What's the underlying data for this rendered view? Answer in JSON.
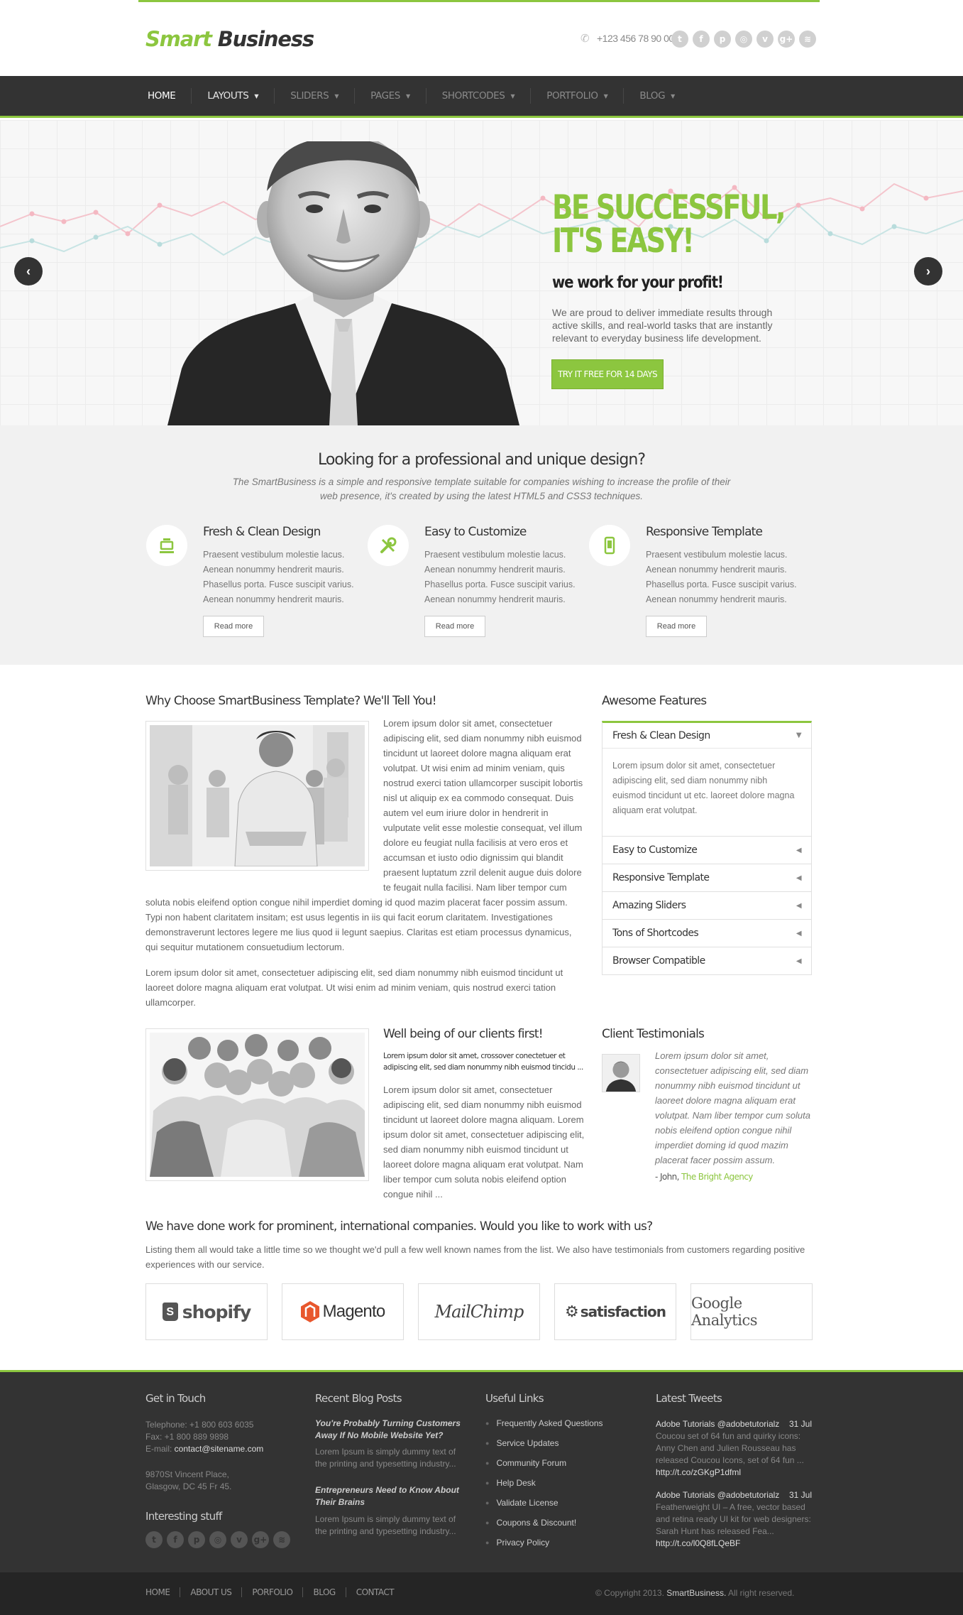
{
  "brand": {
    "word1": "Smart",
    "word2": "Business"
  },
  "header": {
    "phone": "+123 456 78 90 000",
    "social_icons": [
      "twitter-icon",
      "facebook-icon",
      "pinterest-icon",
      "dribbble-icon",
      "vimeo-icon",
      "googleplus-icon",
      "rss-icon"
    ],
    "social_glyphs": [
      "t",
      "f",
      "p",
      "◎",
      "v",
      "g+",
      "≋"
    ]
  },
  "nav": {
    "items": [
      {
        "label": "HOME"
      },
      {
        "label": "LAYOUTS"
      },
      {
        "label": "SLIDERS"
      },
      {
        "label": "PAGES"
      },
      {
        "label": "SHORTCODES"
      },
      {
        "label": "PORTFOLIO"
      },
      {
        "label": "BLOG"
      }
    ]
  },
  "hero": {
    "title_line1": "BE SUCCESSFUL,",
    "title_line2": "IT'S EASY!",
    "subtitle": "we work for your profit!",
    "text": "We are proud to deliver immediate results through active skills, and real-world tasks that are instantly relevant to everyday business life development.",
    "button": "TRY IT FREE FOR 14 DAYS",
    "prev": "‹",
    "next": "›"
  },
  "features": {
    "title": "Looking for a professional and unique design?",
    "description": "The SmartBusiness is a simple and responsive template suitable for companies wishing to increase the profile of their web presence, it's created by using the latest HTML5 and CSS3 techniques.",
    "items": [
      {
        "title": "Fresh & Clean Design",
        "text": "Praesent vestibulum molestie lacus. Aenean nonummy hendrerit mauris. Phasellus porta. Fusce suscipit varius. Aenean nonummy hendrerit mauris.",
        "button": "Read more"
      },
      {
        "title": "Easy to Customize",
        "text": "Praesent vestibulum molestie lacus. Aenean nonummy hendrerit mauris. Phasellus porta. Fusce suscipit varius. Aenean nonummy hendrerit mauris.",
        "button": "Read more"
      },
      {
        "title": "Responsive Template",
        "text": "Praesent vestibulum molestie lacus. Aenean nonummy hendrerit mauris. Phasellus porta. Fusce suscipit varius. Aenean nonummy hendrerit mauris.",
        "button": "Read more"
      }
    ]
  },
  "why": {
    "title": "Why Choose SmartBusiness Template? We'll Tell You!",
    "para1": "Lorem ipsum dolor sit amet, consectetuer adipiscing elit, sed diam nonummy nibh euismod tincidunt ut laoreet dolore magna aliquam erat volutpat. Ut wisi enim ad minim veniam, quis nostrud exerci tation ullamcorper suscipit lobortis nisl ut aliquip ex ea commodo consequat. Duis autem vel eum iriure dolor in hendrerit in vulputate velit esse molestie consequat, vel illum dolore eu feugiat nulla facilisis at vero eros et accumsan et iusto odio dignissim qui blandit praesent luptatum zzril delenit augue duis dolore te feugait nulla facilisi. Nam liber tempor cum soluta nobis eleifend option congue nihil imperdiet doming id quod mazim placerat facer possim assum. Typi non habent claritatem insitam; est usus legentis in iis qui facit eorum claritatem. Investigationes demonstraverunt lectores legere me lius quod ii legunt saepius. Claritas est etiam processus dynamicus, qui sequitur mutationem consuetudium lectorum.",
    "para2": "Lorem ipsum dolor sit amet, consectetuer adipiscing elit, sed diam nonummy nibh euismod tincidunt ut laoreet dolore magna aliquam erat volutpat. Ut wisi enim ad minim veniam, quis nostrud exerci tation ullamcorper."
  },
  "awesome": {
    "title": "Awesome Features",
    "open": {
      "title": "Fresh & Clean Design",
      "text": "Lorem ipsum dolor sit amet, consectetuer adipiscing elit, sed diam nonummy nibh euismod tincidunt ut etc. laoreet dolore magna aliquam erat volutpat."
    },
    "items": [
      "Easy to Customize",
      "Responsive Template",
      "Amazing Sliders",
      "Tons of Shortcodes",
      "Browser Compatible"
    ]
  },
  "wellbeing": {
    "title": "Well being of our clients first!",
    "lead": "Lorem ipsum dolor sit amet, crossover conectetuer et adipiscing elit, sed diam nonummy nibh euismod tincidu ...",
    "text": "Lorem ipsum dolor sit amet, consectetuer adipiscing elit, sed diam nonummy nibh euismod tincidunt ut laoreet dolore magna aliquam. Lorem ipsum dolor sit amet, consectetuer adipiscing elit, sed diam nonummy nibh euismod tincidunt ut laoreet dolore magna aliquam erat volutpat. Nam liber tempor cum soluta nobis eleifend option congue nihil ..."
  },
  "testimonials": {
    "title": "Client Testimonials",
    "quote": "Lorem ipsum dolor sit amet, consectetuer adipiscing elit, sed diam nonummy nibh euismod tincidunt ut laoreet dolore magna aliquam erat volutpat. Nam liber tempor cum soluta nobis eleifend option congue nihil imperdiet doming id quod mazim placerat facer possim assum.",
    "author": "- John,",
    "company": "The Bright Agency"
  },
  "clients": {
    "title": "We have done work for prominent, international companies. Would you like to work with us?",
    "text": "Listing them all would take a little time so we thought we'd pull a few well known names from the list. We also have testimonials from customers regarding positive experiences with our service.",
    "logos": [
      "shopify",
      "Magento",
      "MailChimp",
      "satisfaction",
      "Google Analytics"
    ]
  },
  "footer": {
    "contact": {
      "title": "Get in Touch",
      "telephone": "Telephone: +1 800 603 6035",
      "fax": "Fax: +1 800 889 9898",
      "email_label": "E-mail: ",
      "email": "contact@sitename.com",
      "address1": "9870St Vincent Place,",
      "address2": "Glasgow, DC 45 Fr 45."
    },
    "interesting": {
      "title": "Interesting stuff"
    },
    "blog": {
      "title": "Recent Blog Posts",
      "posts": [
        {
          "title": "You're Probably Turning Customers Away If No Mobile Website Yet?",
          "text": "Lorem Ipsum is simply dummy text of the printing and typesetting industry..."
        },
        {
          "title": "Entrepreneurs Need to Know About Their Brains",
          "text": "Lorem Ipsum is simply dummy text of the printing and typesetting industry..."
        }
      ]
    },
    "links": {
      "title": "Useful Links",
      "items": [
        "Frequently Asked Questions",
        "Service Updates",
        "Community Forum",
        "Help Desk",
        "Validate License",
        "Coupons & Discount!",
        "Privacy Policy"
      ]
    },
    "tweets": {
      "title": "Latest Tweets",
      "items": [
        {
          "author": "Adobe Tutorials @adobetutorialz",
          "date": "31 Jul",
          "text": "Coucou set of 64 fun and quirky icons: Anny Chen and Julien Rousseau has released Coucou Icons, set of 64 fun ...",
          "link": "http://t.co/zGKgP1dfml"
        },
        {
          "author": "Adobe Tutorials @adobetutorialz",
          "date": "31 Jul",
          "text": "Featherweight UI – A free, vector based and retina ready UI kit for web designers: Sarah Hunt has released Fea...",
          "link": "http://t.co/l0Q8fLQeBF"
        }
      ]
    }
  },
  "bottom": {
    "nav": [
      "HOME",
      "ABOUT US",
      "PORFOLIO",
      "BLOG",
      "CONTACT"
    ],
    "copy_prefix": "© Copyright 2013.",
    "copy_brand": "SmartBusiness.",
    "copy_suffix": "All right reserved."
  },
  "colors": {
    "accent": "#8cc63f",
    "dark": "#333333",
    "footer_bottom": "#252525"
  }
}
